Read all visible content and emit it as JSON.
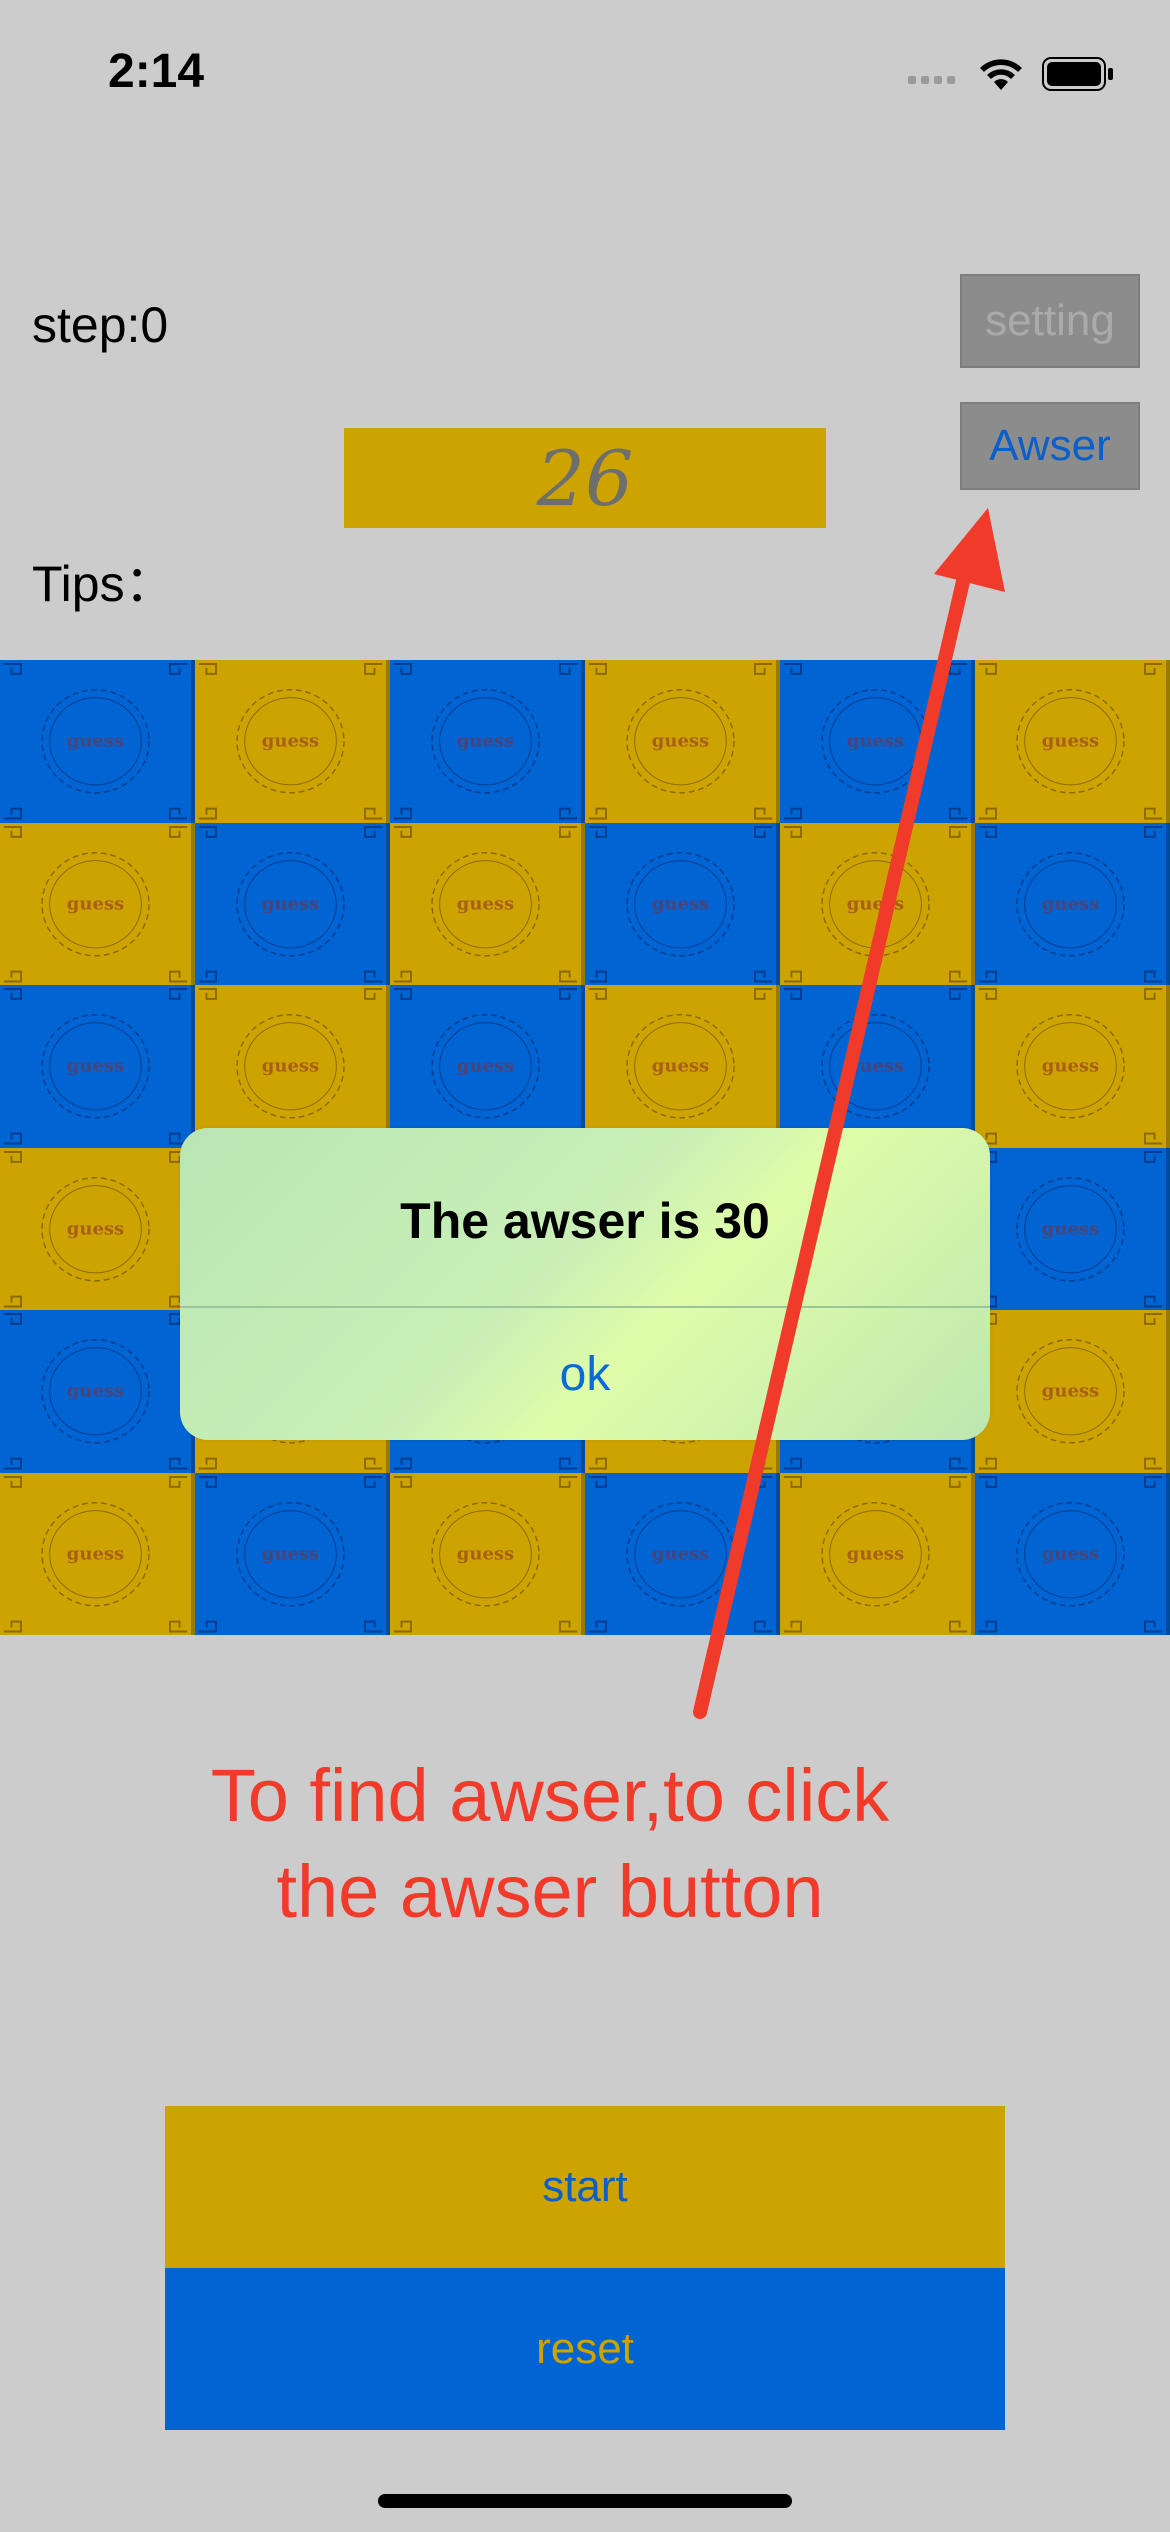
{
  "status_bar": {
    "time": "2:14"
  },
  "game": {
    "step_label": "step:0",
    "tips_label": "Tips：",
    "current_number": "26",
    "setting_label": "setting",
    "awser_label": "Awser",
    "tile_text": "guess",
    "tile_colors": {
      "gold": "#cca300",
      "blue": "#0064d2"
    },
    "grid": [
      [
        "blue",
        "gold",
        "blue",
        "gold",
        "blue",
        "gold"
      ],
      [
        "gold",
        "blue",
        "gold",
        "blue",
        "gold",
        "blue"
      ],
      [
        "blue",
        "gold",
        "blue",
        "gold",
        "blue",
        "gold"
      ],
      [
        "gold",
        "blue",
        "gold",
        "blue",
        "gold",
        "blue"
      ],
      [
        "blue",
        "gold",
        "blue",
        "gold",
        "blue",
        "gold"
      ],
      [
        "gold",
        "blue",
        "gold",
        "blue",
        "gold",
        "blue"
      ]
    ]
  },
  "alert": {
    "title": "The awser is 30",
    "ok_label": "ok"
  },
  "annotation": {
    "line1": "To find awser,to click",
    "line2": "the awser button",
    "color": "#f03a2a"
  },
  "controls": {
    "start_label": "start",
    "reset_label": "reset"
  }
}
